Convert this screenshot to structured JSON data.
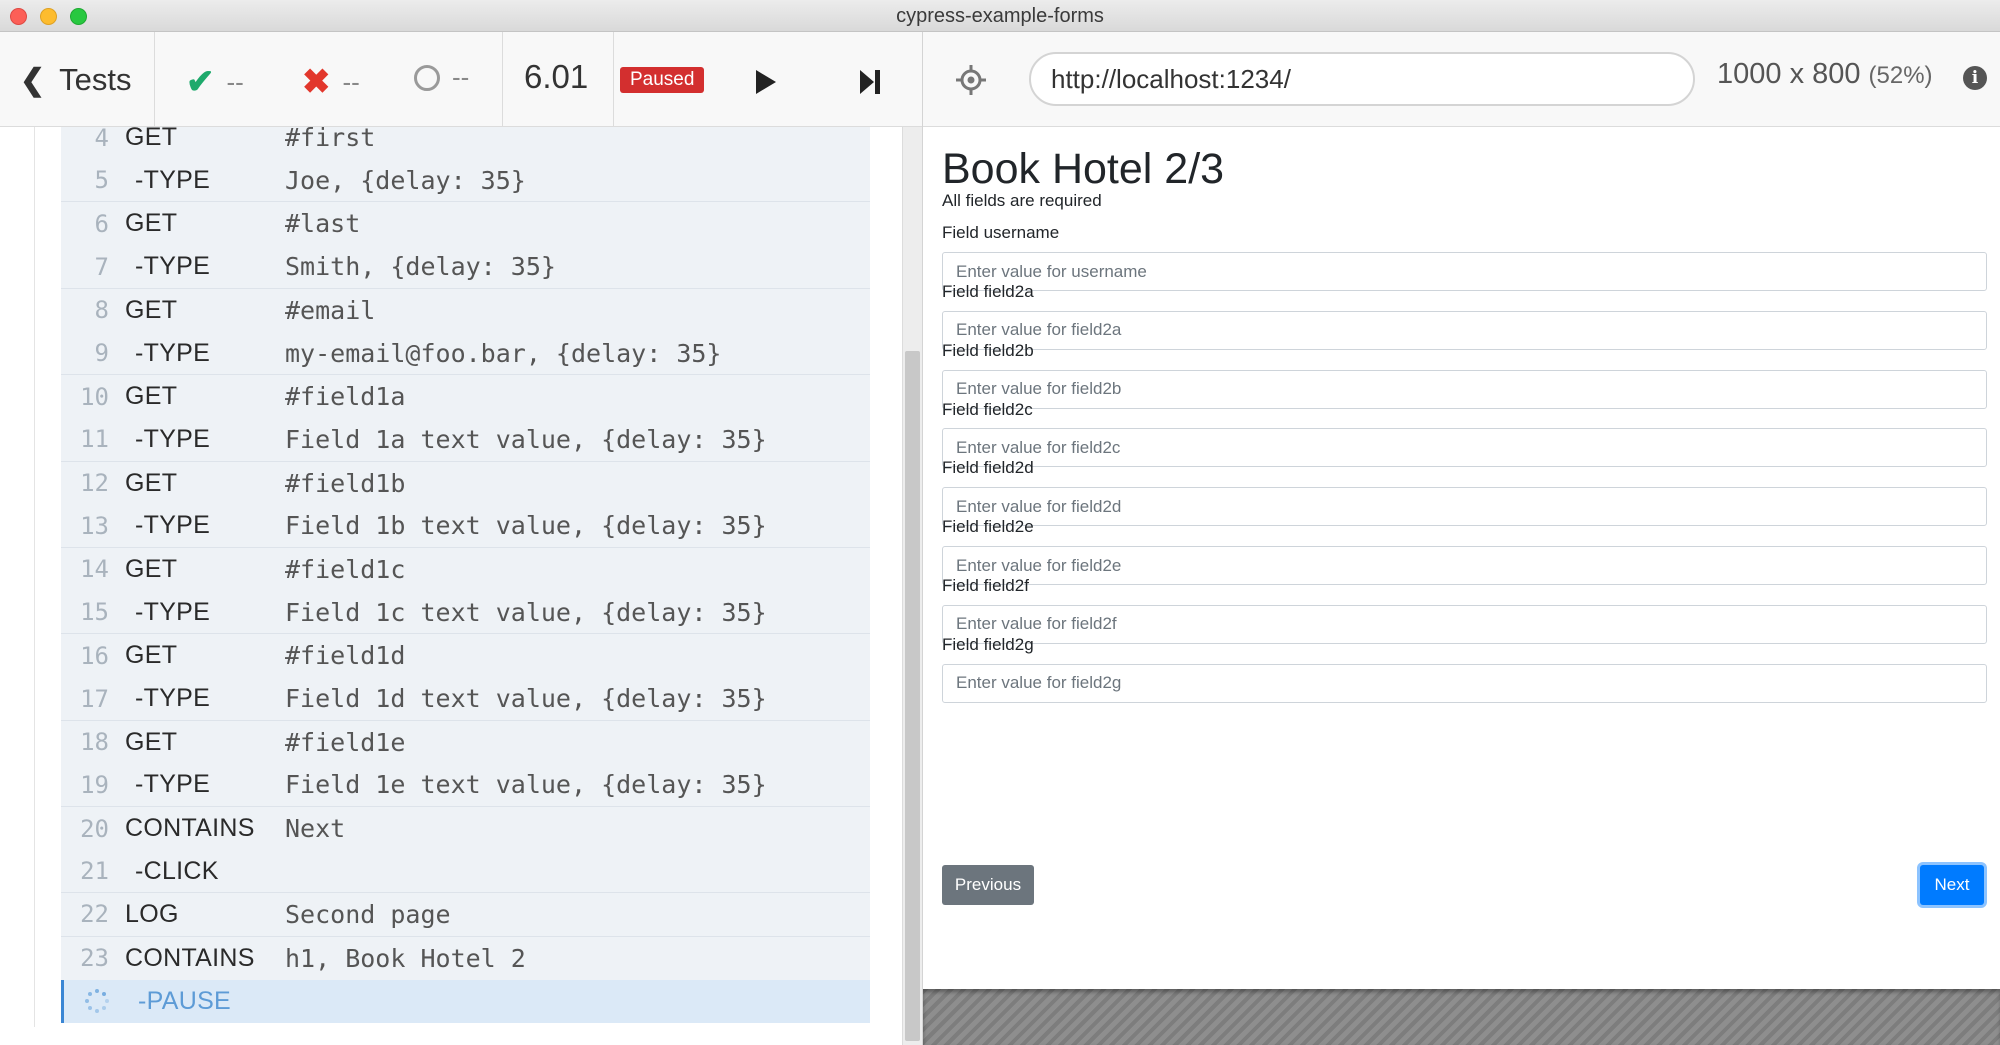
{
  "window": {
    "title": "cypress-example-forms"
  },
  "reporter": {
    "tests_label": "Tests",
    "stats": {
      "passed": "--",
      "failed": "--",
      "pending": "--"
    },
    "duration": "6.01",
    "state_badge": "Paused",
    "commands": [
      {
        "num": "4",
        "name": "GET",
        "child": false,
        "message": "#first"
      },
      {
        "num": "5",
        "name": "-TYPE",
        "child": true,
        "message": "Joe, {delay: 35}"
      },
      {
        "num": "6",
        "name": "GET",
        "child": false,
        "message": "#last"
      },
      {
        "num": "7",
        "name": "-TYPE",
        "child": true,
        "message": "Smith, {delay: 35}"
      },
      {
        "num": "8",
        "name": "GET",
        "child": false,
        "message": "#email"
      },
      {
        "num": "9",
        "name": "-TYPE",
        "child": true,
        "message": "my-email@foo.bar, {delay: 35}"
      },
      {
        "num": "10",
        "name": "GET",
        "child": false,
        "message": "#field1a"
      },
      {
        "num": "11",
        "name": "-TYPE",
        "child": true,
        "message": "Field 1a text value, {delay: 35}"
      },
      {
        "num": "12",
        "name": "GET",
        "child": false,
        "message": "#field1b"
      },
      {
        "num": "13",
        "name": "-TYPE",
        "child": true,
        "message": "Field 1b text value, {delay: 35}"
      },
      {
        "num": "14",
        "name": "GET",
        "child": false,
        "message": "#field1c"
      },
      {
        "num": "15",
        "name": "-TYPE",
        "child": true,
        "message": "Field 1c text value, {delay: 35}"
      },
      {
        "num": "16",
        "name": "GET",
        "child": false,
        "message": "#field1d"
      },
      {
        "num": "17",
        "name": "-TYPE",
        "child": true,
        "message": "Field 1d text value, {delay: 35}"
      },
      {
        "num": "18",
        "name": "GET",
        "child": false,
        "message": "#field1e"
      },
      {
        "num": "19",
        "name": "-TYPE",
        "child": true,
        "message": "Field 1e text value, {delay: 35}"
      },
      {
        "num": "20",
        "name": "CONTAINS",
        "child": false,
        "message": "Next"
      },
      {
        "num": "21",
        "name": "-CLICK",
        "child": true,
        "message": ""
      },
      {
        "num": "22",
        "name": "LOG",
        "child": false,
        "message": "Second page"
      },
      {
        "num": "23",
        "name": "CONTAINS",
        "child": false,
        "message": "h1, Book Hotel 2"
      },
      {
        "num": "",
        "name": "-PAUSE",
        "child": true,
        "message": "",
        "active": true
      }
    ]
  },
  "aut": {
    "url": "http://localhost:1234/",
    "viewport": "1000 x 800",
    "scale": "(52%)",
    "page": {
      "title": "Book Hotel 2/3",
      "subtitle": "All fields are required",
      "fields": [
        {
          "label": "Field username",
          "placeholder": "Enter value for username"
        },
        {
          "label": "Field field2a",
          "placeholder": "Enter value for field2a"
        },
        {
          "label": "Field field2b",
          "placeholder": "Enter value for field2b"
        },
        {
          "label": "Field field2c",
          "placeholder": "Enter value for field2c"
        },
        {
          "label": "Field field2d",
          "placeholder": "Enter value for field2d"
        },
        {
          "label": "Field field2e",
          "placeholder": "Enter value for field2e"
        },
        {
          "label": "Field field2f",
          "placeholder": "Enter value for field2f"
        },
        {
          "label": "Field field2g",
          "placeholder": "Enter value for field2g"
        }
      ],
      "previous_label": "Previous",
      "next_label": "Next"
    }
  },
  "colors": {
    "passed": "#1eaa6c",
    "failed": "#e2372c",
    "paused_badge": "#d32f2f",
    "primary_button": "#007bff",
    "secondary_button": "#6c757d",
    "active_command": "#dbe9f7"
  },
  "icons": {
    "tests_back": "chevron-left-icon",
    "passed": "check-icon",
    "failed": "x-icon",
    "pending": "circle-icon",
    "play": "play-icon",
    "step": "step-forward-icon",
    "selector": "crosshair-icon",
    "info": "info-icon",
    "pause_spinner": "spinner-icon"
  }
}
